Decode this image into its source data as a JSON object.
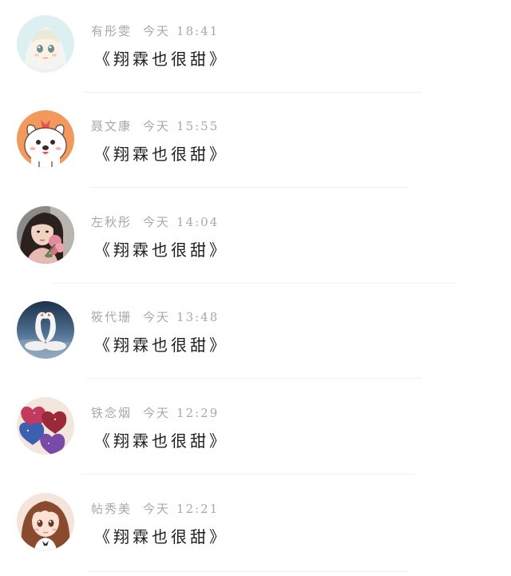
{
  "comments": [
    {
      "name": "有彤雯",
      "day": "今天",
      "time": "18:41",
      "message": "《翔霖也很甜》",
      "avatar_icon": "anime-girl-white-hood-avatar"
    },
    {
      "name": "聂文康",
      "day": "今天",
      "time": "15:55",
      "message": "《翔霖也很甜》",
      "avatar_icon": "cartoon-dog-avatar"
    },
    {
      "name": "左秋彤",
      "day": "今天",
      "time": "14:04",
      "message": "《翔霖也很甜》",
      "avatar_icon": "girl-with-roses-avatar"
    },
    {
      "name": "筱代珊",
      "day": "今天",
      "time": "13:48",
      "message": "《翔霖也很甜》",
      "avatar_icon": "swans-heart-avatar"
    },
    {
      "name": "铁念烟",
      "day": "今天",
      "time": "12:29",
      "message": "《翔霖也很甜》",
      "avatar_icon": "glitter-hearts-avatar"
    },
    {
      "name": "帖秀美",
      "day": "今天",
      "time": "12:21",
      "message": "《翔霖也很甜》",
      "avatar_icon": "anime-girl-brown-hair-avatar"
    }
  ]
}
